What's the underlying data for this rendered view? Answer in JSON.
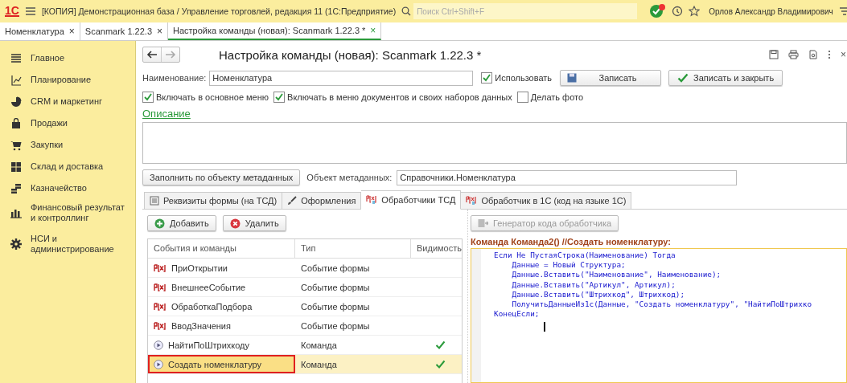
{
  "window": {
    "logo": "1С",
    "title": "[КОПИЯ] Демонстрационная база / Управление торговлей, редакция 11  (1С:Предприятие)",
    "search": {
      "placeholder": "Поиск Ctrl+Shift+F"
    },
    "user": "Орлов Александр Владимирович"
  },
  "open_tabs": [
    {
      "label": "Номенклатура",
      "close": "×",
      "selected": false
    },
    {
      "label": "Scanmark 1.22.3",
      "close": "×",
      "selected": false
    },
    {
      "label": "Настройка команды (новая): Scanmark 1.22.3 *",
      "close": "×",
      "selected": true
    }
  ],
  "sidebar": {
    "items": [
      {
        "label": "Главное"
      },
      {
        "label": "Планирование"
      },
      {
        "label": "CRM и маркетинг"
      },
      {
        "label": "Продажи"
      },
      {
        "label": "Закупки"
      },
      {
        "label": "Склад и доставка"
      },
      {
        "label": "Казначейство"
      },
      {
        "label": "Финансовый результат и контроллинг"
      },
      {
        "label": "НСИ и администрирование"
      }
    ]
  },
  "form": {
    "title": "Настройка команды (новая): Scanmark 1.22.3 *",
    "close": "×",
    "name": {
      "label": "Наименование:",
      "value": "Номенклатура"
    },
    "use": {
      "label": "Использовать",
      "checked": true
    },
    "save_button": "Записать",
    "save_close_button": "Записать и закрыть",
    "options": [
      {
        "label": "Включать в основное меню",
        "checked": true
      },
      {
        "label": "Включать в меню документов и своих наборов данных",
        "checked": true
      },
      {
        "label": "Делать фото",
        "checked": false
      }
    ],
    "description_link": "Описание",
    "fill_button": "Заполнить по объекту метаданных",
    "metadata": {
      "label": "Объект метаданных:",
      "value": "Справочники.Номенклатура"
    },
    "tabs": [
      {
        "label": "Реквизиты формы (на ТСД)",
        "kind": "attributes",
        "selected": false
      },
      {
        "label": "Оформления",
        "kind": "design",
        "selected": false
      },
      {
        "label": "Обработчики ТСД",
        "kind": "handlers",
        "selected": true
      },
      {
        "label": "Обработчик в 1С  (код на языке 1С)",
        "kind": "handlers",
        "selected": false
      }
    ],
    "add_button": "Добавить",
    "delete_button": "Удалить",
    "table": {
      "columns": [
        "События и команды",
        "Тип",
        "Видимость"
      ],
      "rows": [
        {
          "kind": "event",
          "name": "ПриОткрытии",
          "type": "Событие формы",
          "visible": false,
          "selected": false
        },
        {
          "kind": "event",
          "name": "ВнешнееСобытие",
          "type": "Событие формы",
          "visible": false,
          "selected": false
        },
        {
          "kind": "event",
          "name": "ОбработкаПодбора",
          "type": "Событие формы",
          "visible": false,
          "selected": false
        },
        {
          "kind": "event",
          "name": "ВводЗначения",
          "type": "Событие формы",
          "visible": false,
          "selected": false
        },
        {
          "kind": "command",
          "name": "НайтиПоШтрихкоду",
          "type": "Команда",
          "visible": true,
          "selected": false
        },
        {
          "kind": "command",
          "name": "Создать номенклатуру",
          "type": "Команда",
          "visible": true,
          "selected": true
        }
      ]
    },
    "generator_button": {
      "label": "Генератор кода обработчика",
      "disabled": true
    },
    "code_header": "Команда Команда2() //Создать номенклатуру:",
    "code_lines": [
      "Если Не ПустаяСтрока(Наименование) Тогда",
      "\tДанные = Новый Структура;",
      "\tДанные.Вставить(\"Наименование\", Наименование);",
      "\tДанные.Вставить(\"Артикул\", Артикул);",
      "\tДанные.Вставить(\"Штрихкод\", Штрихкод);",
      "\tПолучитьДанныеИз1с(Данные, \"Создать номенклатуру\", \"НайтиПоШтрихко",
      "КонецЕсли;"
    ]
  }
}
